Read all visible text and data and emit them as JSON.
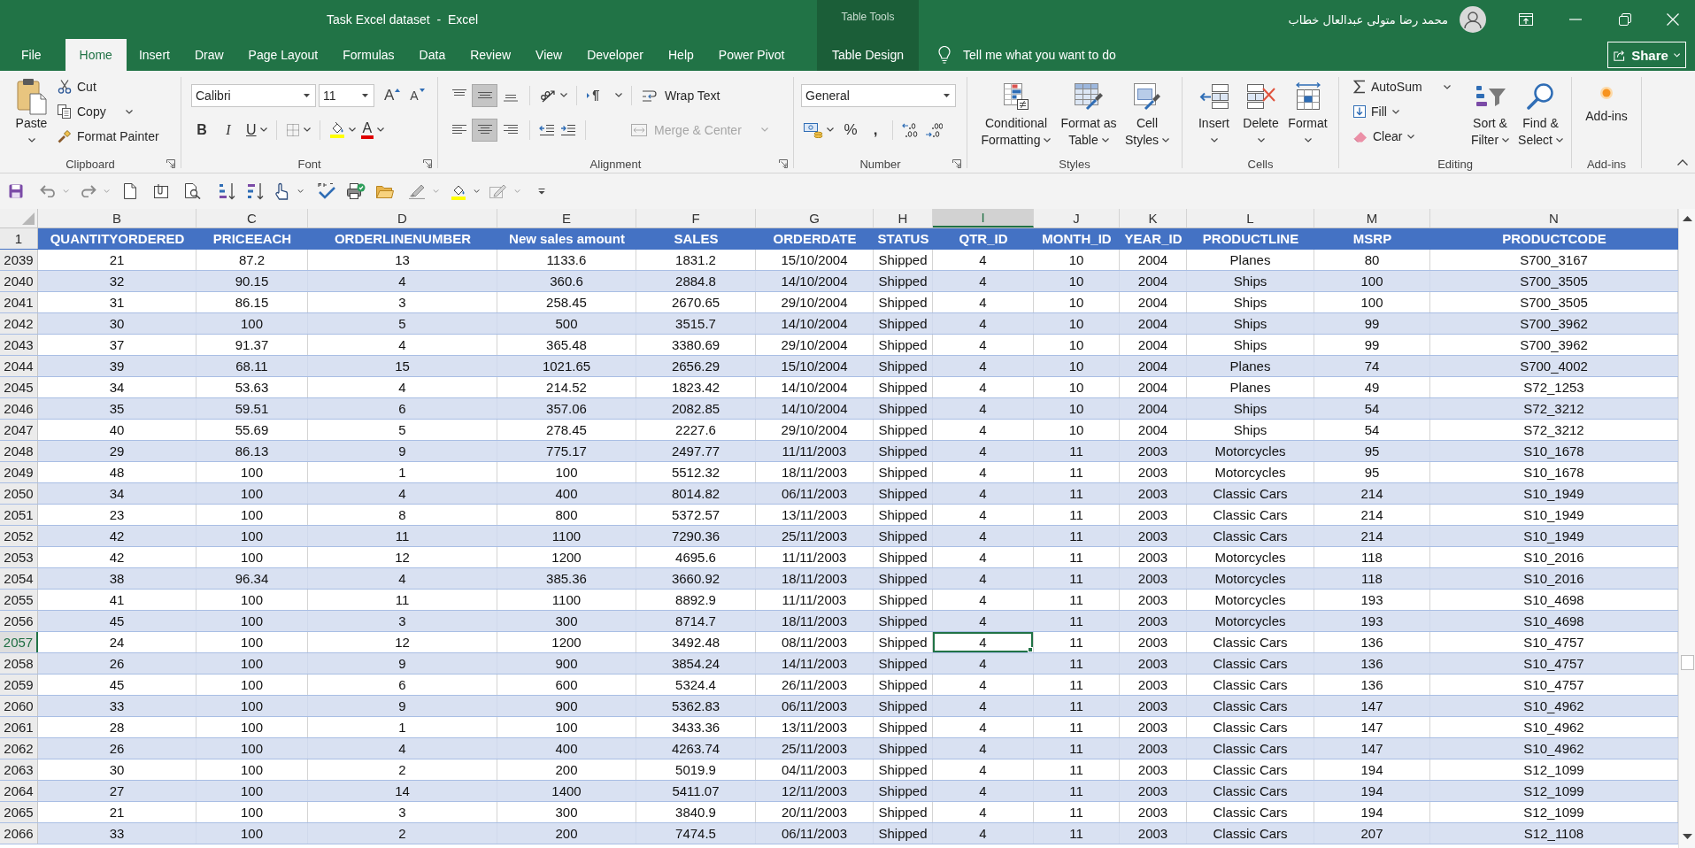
{
  "window": {
    "title": "Task Excel dataset  -  Excel",
    "context_group": "Table Tools",
    "user_name": "محمد رضا متولى عبدالعال خطاب"
  },
  "tabs": [
    {
      "label": "File",
      "selected": false,
      "contextual": false
    },
    {
      "label": "Home",
      "selected": true,
      "contextual": false
    },
    {
      "label": "Insert",
      "selected": false,
      "contextual": false
    },
    {
      "label": "Draw",
      "selected": false,
      "contextual": false
    },
    {
      "label": "Page Layout",
      "selected": false,
      "contextual": false
    },
    {
      "label": "Formulas",
      "selected": false,
      "contextual": false
    },
    {
      "label": "Data",
      "selected": false,
      "contextual": false
    },
    {
      "label": "Review",
      "selected": false,
      "contextual": false
    },
    {
      "label": "View",
      "selected": false,
      "contextual": false
    },
    {
      "label": "Developer",
      "selected": false,
      "contextual": false
    },
    {
      "label": "Help",
      "selected": false,
      "contextual": false
    },
    {
      "label": "Power Pivot",
      "selected": false,
      "contextual": false
    },
    {
      "label": "Table Design",
      "selected": false,
      "contextual": true
    }
  ],
  "tell_me": {
    "placeholder": "Tell me what you want to do"
  },
  "share": {
    "label": "Share"
  },
  "ribbon": {
    "clipboard": {
      "label": "Clipboard",
      "paste": "Paste",
      "cut": "Cut",
      "copy": "Copy",
      "format_painter": "Format Painter"
    },
    "font": {
      "label": "Font",
      "font_name": "Calibri",
      "font_size": "11",
      "grow": "A",
      "shrink": "A",
      "bold": "B",
      "italic": "I",
      "underline": "U",
      "font_color": "A"
    },
    "alignment": {
      "label": "Alignment",
      "vertical": [
        {
          "kind": "top",
          "selected": false
        },
        {
          "kind": "middle",
          "selected": true
        },
        {
          "kind": "bottom",
          "selected": false
        }
      ],
      "horizontal": [
        {
          "kind": "left",
          "selected": false
        },
        {
          "kind": "center",
          "selected": true
        },
        {
          "kind": "right",
          "selected": false
        }
      ],
      "wrap_text": "Wrap Text",
      "merge_center": {
        "label": "Merge & Center",
        "disabled": true
      }
    },
    "number": {
      "label": "Number",
      "format": "General",
      "percent": "%",
      "comma": ","
    },
    "styles": {
      "label": "Styles",
      "buttons": [
        {
          "kind": "conditional",
          "lines": [
            "Conditional",
            "Formatting"
          ]
        },
        {
          "kind": "table",
          "lines": [
            "Format as",
            "Table"
          ]
        },
        {
          "kind": "cell_styles",
          "lines": [
            "Cell",
            "Styles"
          ]
        }
      ]
    },
    "cells": {
      "label": "Cells",
      "buttons": [
        {
          "kind": "insert",
          "label": "Insert"
        },
        {
          "kind": "delete",
          "label": "Delete"
        },
        {
          "kind": "format",
          "label": "Format"
        }
      ]
    },
    "editing": {
      "label": "Editing",
      "autosum": "AutoSum",
      "fill": "Fill",
      "clear": "Clear",
      "buttons": [
        {
          "kind": "sort",
          "lines": [
            "Sort &",
            "Filter"
          ]
        },
        {
          "kind": "find",
          "lines": [
            "Find &",
            "Select"
          ]
        }
      ]
    },
    "addins": {
      "label": "Add-ins",
      "button": "Add-ins"
    }
  },
  "sheet": {
    "columns": [
      {
        "letter": "B",
        "selected": false
      },
      {
        "letter": "C",
        "selected": false
      },
      {
        "letter": "D",
        "selected": false
      },
      {
        "letter": "E",
        "selected": false
      },
      {
        "letter": "F",
        "selected": false
      },
      {
        "letter": "G",
        "selected": false
      },
      {
        "letter": "H",
        "selected": false
      },
      {
        "letter": "I",
        "selected": true
      },
      {
        "letter": "J",
        "selected": false
      },
      {
        "letter": "K",
        "selected": false
      },
      {
        "letter": "L",
        "selected": false
      },
      {
        "letter": "M",
        "selected": false
      },
      {
        "letter": "N",
        "selected": false
      }
    ],
    "header_row_number": "1",
    "banded": true,
    "headers": [
      "QUANTITYORDERED",
      "PRICEEACH",
      "ORDERLINENUMBER",
      "New sales amount",
      "SALES",
      "ORDERDATE",
      "STATUS",
      "QTR_ID",
      "MONTH_ID",
      "YEAR_ID",
      "PRODUCTLINE",
      "MSRP",
      "PRODUCTCODE"
    ],
    "rows": [
      {
        "number": "2039",
        "selected": false,
        "cells": [
          "21",
          "87.2",
          "13",
          "1133.6",
          "1831.2",
          "15/10/2004",
          "Shipped",
          "4",
          "10",
          "2004",
          "Planes",
          "80",
          "S700_3167"
        ]
      },
      {
        "number": "2040",
        "selected": false,
        "cells": [
          "32",
          "90.15",
          "4",
          "360.6",
          "2884.8",
          "14/10/2004",
          "Shipped",
          "4",
          "10",
          "2004",
          "Ships",
          "100",
          "S700_3505"
        ]
      },
      {
        "number": "2041",
        "selected": false,
        "cells": [
          "31",
          "86.15",
          "3",
          "258.45",
          "2670.65",
          "29/10/2004",
          "Shipped",
          "4",
          "10",
          "2004",
          "Ships",
          "100",
          "S700_3505"
        ]
      },
      {
        "number": "2042",
        "selected": false,
        "cells": [
          "30",
          "100",
          "5",
          "500",
          "3515.7",
          "14/10/2004",
          "Shipped",
          "4",
          "10",
          "2004",
          "Ships",
          "99",
          "S700_3962"
        ]
      },
      {
        "number": "2043",
        "selected": false,
        "cells": [
          "37",
          "91.37",
          "4",
          "365.48",
          "3380.69",
          "29/10/2004",
          "Shipped",
          "4",
          "10",
          "2004",
          "Ships",
          "99",
          "S700_3962"
        ]
      },
      {
        "number": "2044",
        "selected": false,
        "cells": [
          "39",
          "68.11",
          "15",
          "1021.65",
          "2656.29",
          "15/10/2004",
          "Shipped",
          "4",
          "10",
          "2004",
          "Planes",
          "74",
          "S700_4002"
        ]
      },
      {
        "number": "2045",
        "selected": false,
        "cells": [
          "34",
          "53.63",
          "4",
          "214.52",
          "1823.42",
          "14/10/2004",
          "Shipped",
          "4",
          "10",
          "2004",
          "Planes",
          "49",
          "S72_1253"
        ]
      },
      {
        "number": "2046",
        "selected": false,
        "cells": [
          "35",
          "59.51",
          "6",
          "357.06",
          "2082.85",
          "14/10/2004",
          "Shipped",
          "4",
          "10",
          "2004",
          "Ships",
          "54",
          "S72_3212"
        ]
      },
      {
        "number": "2047",
        "selected": false,
        "cells": [
          "40",
          "55.69",
          "5",
          "278.45",
          "2227.6",
          "29/10/2004",
          "Shipped",
          "4",
          "10",
          "2004",
          "Ships",
          "54",
          "S72_3212"
        ]
      },
      {
        "number": "2048",
        "selected": false,
        "cells": [
          "29",
          "86.13",
          "9",
          "775.17",
          "2497.77",
          "11/11/2003",
          "Shipped",
          "4",
          "11",
          "2003",
          "Motorcycles",
          "95",
          "S10_1678"
        ]
      },
      {
        "number": "2049",
        "selected": false,
        "cells": [
          "48",
          "100",
          "1",
          "100",
          "5512.32",
          "18/11/2003",
          "Shipped",
          "4",
          "11",
          "2003",
          "Motorcycles",
          "95",
          "S10_1678"
        ]
      },
      {
        "number": "2050",
        "selected": false,
        "cells": [
          "34",
          "100",
          "4",
          "400",
          "8014.82",
          "06/11/2003",
          "Shipped",
          "4",
          "11",
          "2003",
          "Classic Cars",
          "214",
          "S10_1949"
        ]
      },
      {
        "number": "2051",
        "selected": false,
        "cells": [
          "23",
          "100",
          "8",
          "800",
          "5372.57",
          "13/11/2003",
          "Shipped",
          "4",
          "11",
          "2003",
          "Classic Cars",
          "214",
          "S10_1949"
        ]
      },
      {
        "number": "2052",
        "selected": false,
        "cells": [
          "42",
          "100",
          "11",
          "1100",
          "7290.36",
          "25/11/2003",
          "Shipped",
          "4",
          "11",
          "2003",
          "Classic Cars",
          "214",
          "S10_1949"
        ]
      },
      {
        "number": "2053",
        "selected": false,
        "cells": [
          "42",
          "100",
          "12",
          "1200",
          "4695.6",
          "11/11/2003",
          "Shipped",
          "4",
          "11",
          "2003",
          "Motorcycles",
          "118",
          "S10_2016"
        ]
      },
      {
        "number": "2054",
        "selected": false,
        "cells": [
          "38",
          "96.34",
          "4",
          "385.36",
          "3660.92",
          "18/11/2003",
          "Shipped",
          "4",
          "11",
          "2003",
          "Motorcycles",
          "118",
          "S10_2016"
        ]
      },
      {
        "number": "2055",
        "selected": false,
        "cells": [
          "41",
          "100",
          "11",
          "1100",
          "8892.9",
          "11/11/2003",
          "Shipped",
          "4",
          "11",
          "2003",
          "Motorcycles",
          "193",
          "S10_4698"
        ]
      },
      {
        "number": "2056",
        "selected": false,
        "cells": [
          "45",
          "100",
          "3",
          "300",
          "8714.7",
          "18/11/2003",
          "Shipped",
          "4",
          "11",
          "2003",
          "Motorcycles",
          "193",
          "S10_4698"
        ]
      },
      {
        "number": "2057",
        "selected": true,
        "cells": [
          "24",
          "100",
          "12",
          "1200",
          "3492.48",
          "08/11/2003",
          "Shipped",
          "4",
          "11",
          "2003",
          "Classic Cars",
          "136",
          "S10_4757"
        ]
      },
      {
        "number": "2058",
        "selected": false,
        "cells": [
          "26",
          "100",
          "9",
          "900",
          "3854.24",
          "14/11/2003",
          "Shipped",
          "4",
          "11",
          "2003",
          "Classic Cars",
          "136",
          "S10_4757"
        ]
      },
      {
        "number": "2059",
        "selected": false,
        "cells": [
          "45",
          "100",
          "6",
          "600",
          "5324.4",
          "26/11/2003",
          "Shipped",
          "4",
          "11",
          "2003",
          "Classic Cars",
          "136",
          "S10_4757"
        ]
      },
      {
        "number": "2060",
        "selected": false,
        "cells": [
          "33",
          "100",
          "9",
          "900",
          "5362.83",
          "06/11/2003",
          "Shipped",
          "4",
          "11",
          "2003",
          "Classic Cars",
          "147",
          "S10_4962"
        ]
      },
      {
        "number": "2061",
        "selected": false,
        "cells": [
          "28",
          "100",
          "1",
          "100",
          "3433.36",
          "13/11/2003",
          "Shipped",
          "4",
          "11",
          "2003",
          "Classic Cars",
          "147",
          "S10_4962"
        ]
      },
      {
        "number": "2062",
        "selected": false,
        "cells": [
          "26",
          "100",
          "4",
          "400",
          "4263.74",
          "25/11/2003",
          "Shipped",
          "4",
          "11",
          "2003",
          "Classic Cars",
          "147",
          "S10_4962"
        ]
      },
      {
        "number": "2063",
        "selected": false,
        "cells": [
          "30",
          "100",
          "2",
          "200",
          "5019.9",
          "04/11/2003",
          "Shipped",
          "4",
          "11",
          "2003",
          "Classic Cars",
          "194",
          "S12_1099"
        ]
      },
      {
        "number": "2064",
        "selected": false,
        "cells": [
          "27",
          "100",
          "14",
          "1400",
          "5411.07",
          "12/11/2003",
          "Shipped",
          "4",
          "11",
          "2003",
          "Classic Cars",
          "194",
          "S12_1099"
        ]
      },
      {
        "number": "2065",
        "selected": false,
        "cells": [
          "21",
          "100",
          "3",
          "300",
          "3840.9",
          "20/11/2003",
          "Shipped",
          "4",
          "11",
          "2003",
          "Classic Cars",
          "194",
          "S12_1099"
        ]
      },
      {
        "number": "2066",
        "selected": false,
        "cells": [
          "33",
          "100",
          "2",
          "200",
          "7474.5",
          "06/11/2003",
          "Shipped",
          "4",
          "11",
          "2003",
          "Classic Cars",
          "207",
          "S12_1108"
        ]
      }
    ]
  }
}
